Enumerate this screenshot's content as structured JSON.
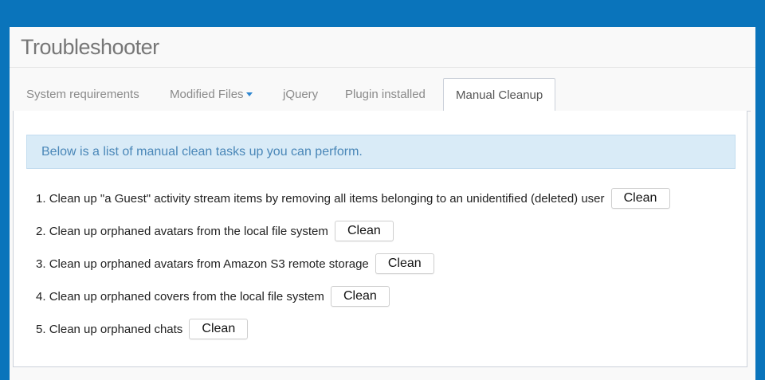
{
  "header": {
    "title": "Troubleshooter"
  },
  "tabs": [
    {
      "label": "System requirements",
      "active": false
    },
    {
      "label": "Modified Files",
      "active": false,
      "has_dropdown": true
    },
    {
      "label": "jQuery",
      "active": false
    },
    {
      "label": "Plugin installed",
      "active": false
    },
    {
      "label": "Manual Cleanup",
      "active": true
    }
  ],
  "alert": {
    "text": "Below is a list of manual clean tasks up you can perform."
  },
  "tasks": [
    {
      "number": "1.",
      "text": "Clean up \"a Guest\" activity stream items by removing all items belonging to an unidentified (deleted) user",
      "button_label": "Clean"
    },
    {
      "number": "2.",
      "text": "Clean up orphaned avatars from the local file system",
      "button_label": "Clean"
    },
    {
      "number": "3.",
      "text": "Clean up orphaned avatars from Amazon S3 remote storage",
      "button_label": "Clean"
    },
    {
      "number": "4.",
      "text": "Clean up orphaned covers from the local file system",
      "button_label": "Clean"
    },
    {
      "number": "5.",
      "text": "Clean up orphaned chats",
      "button_label": "Clean"
    }
  ],
  "colors": {
    "background": "#0a74bb",
    "alert_bg": "#d9ebf7",
    "alert_text": "#4a87b8",
    "caret": "#2f87d1"
  },
  "icons": {
    "dropdown": "caret-down-icon"
  }
}
